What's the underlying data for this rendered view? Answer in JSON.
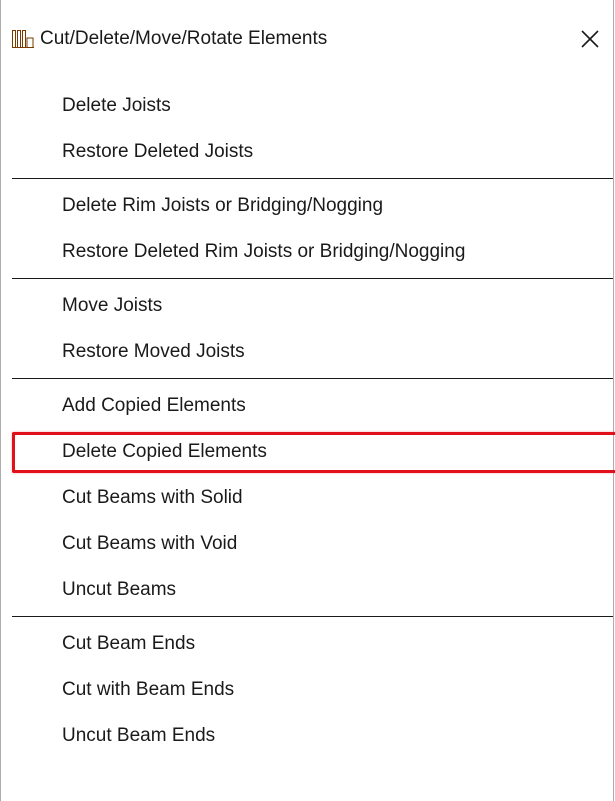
{
  "window": {
    "title": "Cut/Delete/Move/Rotate Elements",
    "icon": "joists-icon",
    "close_icon": "close-icon"
  },
  "highlight_color": "#e2101a",
  "groups": [
    {
      "items": [
        {
          "label": "Delete Joists"
        },
        {
          "label": "Restore Deleted Joists"
        }
      ]
    },
    {
      "items": [
        {
          "label": "Delete Rim Joists or Bridging/Nogging"
        },
        {
          "label": "Restore Deleted Rim Joists or Bridging/Nogging"
        }
      ]
    },
    {
      "items": [
        {
          "label": "Move Joists"
        },
        {
          "label": "Restore Moved Joists"
        }
      ]
    },
    {
      "items": [
        {
          "label": "Add Copied Elements"
        },
        {
          "label": "Delete Copied Elements",
          "highlighted": true
        },
        {
          "label": "Cut Beams with Solid"
        },
        {
          "label": "Cut Beams with Void"
        },
        {
          "label": "Uncut Beams"
        }
      ]
    },
    {
      "items": [
        {
          "label": "Cut Beam Ends"
        },
        {
          "label": "Cut with Beam Ends"
        },
        {
          "label": "Uncut Beam Ends"
        }
      ]
    }
  ]
}
